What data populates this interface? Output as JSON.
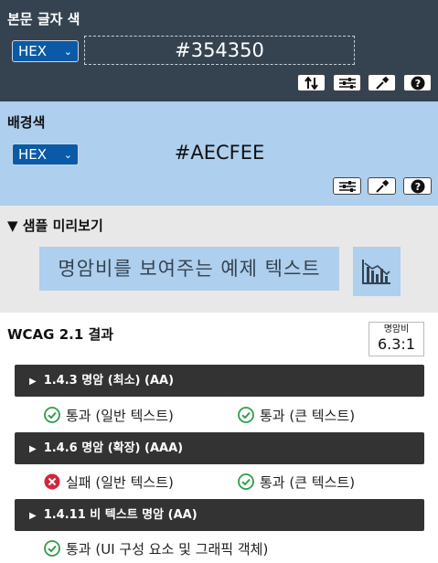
{
  "foreground": {
    "title": "본문 글자 색",
    "format": "HEX",
    "value": "#354350",
    "color": "#354350"
  },
  "background": {
    "title": "배경색",
    "format": "HEX",
    "value": "#AECFEE",
    "color": "#AECFEE"
  },
  "sample": {
    "title": "▼ 샘플 미리보기",
    "text": "명암비를 보여주는 예제 텍스트"
  },
  "wcag": {
    "title": "WCAG 2.1 결과",
    "ratio_label": "명암비",
    "ratio_value": "6.3:1",
    "criteria": [
      {
        "label": "1.4.3 명암 (최소) (AA)",
        "results": [
          {
            "status": "pass",
            "text": "통과 (일반 텍스트)"
          },
          {
            "status": "pass",
            "text": "통과 (큰 텍스트)"
          }
        ]
      },
      {
        "label": "1.4.6 명암 (확장) (AAA)",
        "results": [
          {
            "status": "fail",
            "text": "실패 (일반 텍스트)"
          },
          {
            "status": "pass",
            "text": "통과 (큰 텍스트)"
          }
        ]
      },
      {
        "label": "1.4.11 비 텍스트 명암 (AA)",
        "results": [
          {
            "status": "pass",
            "text": "통과 (UI 구성 요소 및 그래픽 객체)"
          }
        ]
      }
    ]
  },
  "colors": {
    "pass": "#2e9e4a",
    "fail": "#d0263b",
    "select_bg": "#0b5aa8"
  },
  "icons": [
    "swap-icon",
    "sliders-icon",
    "eyedropper-icon",
    "help-icon",
    "chart-icon",
    "check-circle-icon",
    "x-circle-icon",
    "triangle-right-icon"
  ]
}
